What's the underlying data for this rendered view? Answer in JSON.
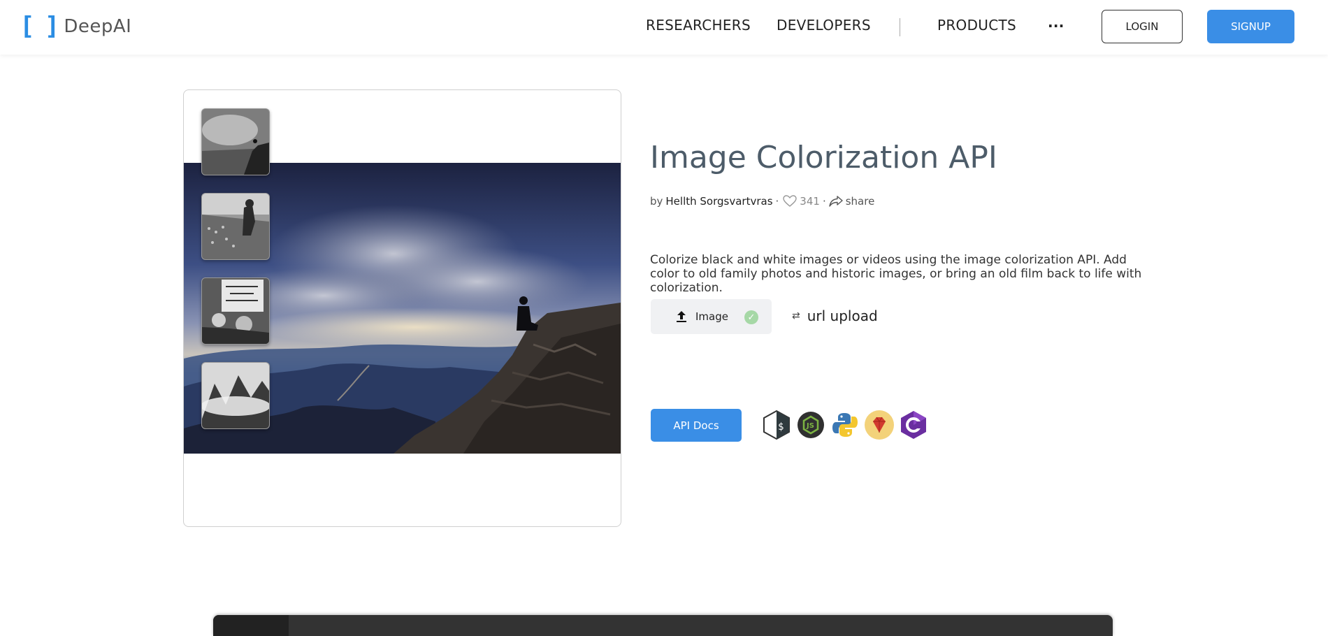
{
  "header": {
    "logo_text": "DeepAI",
    "nav": {
      "researchers": "RESEARCHERS",
      "developers": "DEVELOPERS",
      "products": "PRODUCTS",
      "more": "..."
    },
    "login_label": "LOGIN",
    "signup_label": "SIGNUP"
  },
  "colors": {
    "accent": "#3a8ee6",
    "title": "#4d5c69"
  },
  "main": {
    "title": "Image Colorization API",
    "meta": {
      "by": "by",
      "author": "Hellth Sorgsvartvras",
      "sep": "·",
      "likes": "341",
      "share": "share"
    },
    "description": "Colorize black and white images or videos using the image colorization API. Add color to old family photos and historic images, or bring an old film back to life with colorization.",
    "upload": {
      "label": "Image",
      "url_label": "url upload"
    },
    "api_docs_label": "API Docs",
    "languages": [
      "bash-icon",
      "nodejs-icon",
      "python-icon",
      "ruby-icon",
      "csharp-icon"
    ]
  }
}
